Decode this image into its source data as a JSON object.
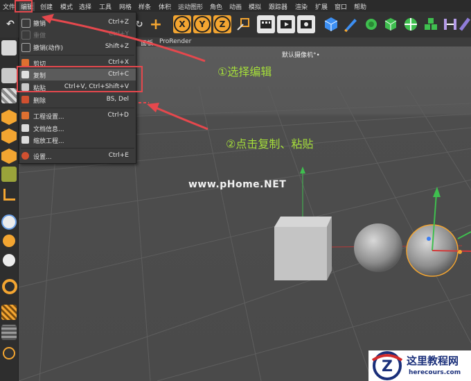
{
  "menubar": [
    "文件",
    "编辑",
    "创建",
    "模式",
    "选择",
    "工具",
    "网格",
    "样条",
    "体积",
    "运动图形",
    "角色",
    "动画",
    "模拟",
    "跟踪器",
    "渲染",
    "扩展",
    "窗口",
    "帮助"
  ],
  "viewport_menu": {
    "item1": "面板",
    "item2": "ProRender"
  },
  "camera_label": "默认摄像机°•",
  "edit_menu": [
    {
      "label": "撤销",
      "shortcut": "Ctrl+Z"
    },
    {
      "label": "重做",
      "shortcut": "Ctrl+Y"
    },
    {
      "label": "撤销(动作)",
      "shortcut": "Shift+Z"
    },
    {
      "label": "剪切",
      "shortcut": "Ctrl+X"
    },
    {
      "label": "复制",
      "shortcut": "Ctrl+C"
    },
    {
      "label": "粘贴",
      "shortcut": "Ctrl+V, Ctrl+Shift+V"
    },
    {
      "label": "删除",
      "shortcut": "BS, Del"
    },
    {
      "label": "工程设置...",
      "shortcut": "Ctrl+D"
    },
    {
      "label": "文档信息...",
      "shortcut": ""
    },
    {
      "label": "缩放工程...",
      "shortcut": ""
    },
    {
      "label": "设置...",
      "shortcut": "Ctrl+E"
    }
  ],
  "annotations": {
    "step1": "①选择编辑",
    "step2": "②点击复制、粘贴"
  },
  "axis_buttons": [
    "X",
    "Y",
    "Z"
  ],
  "watermark": "www.pHome.NET",
  "logo": {
    "letter": "Z",
    "title": "这里教程网",
    "url": "herecours.com"
  },
  "colors": {
    "highlight_box": "#e5484d",
    "annotation_text": "#a5de3a",
    "axis_button": "#f3a531"
  }
}
